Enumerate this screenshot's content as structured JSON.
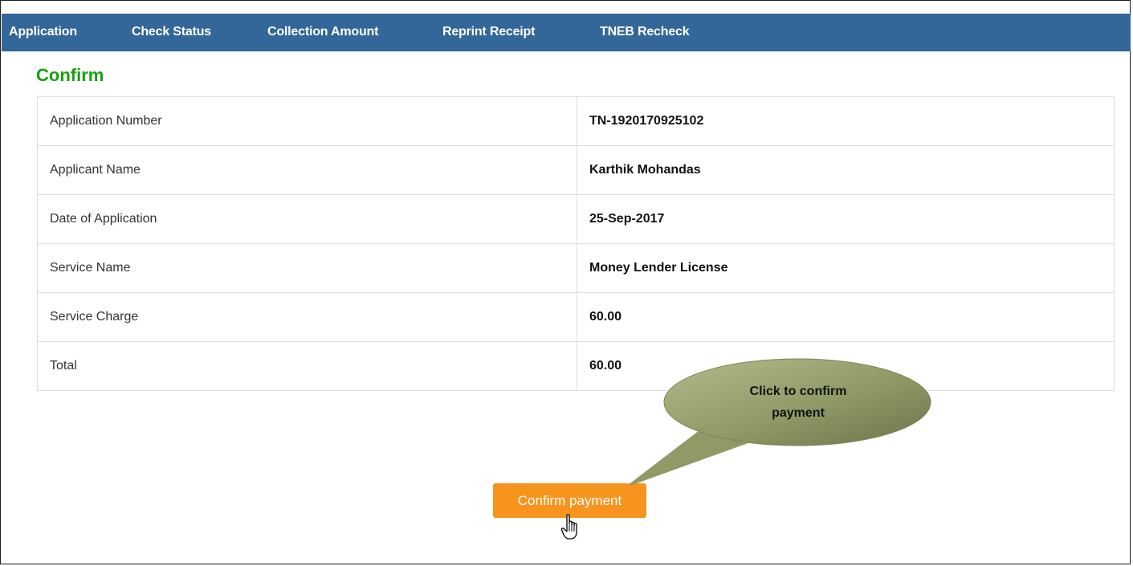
{
  "nav": {
    "items": [
      {
        "label": "Application"
      },
      {
        "label": "Check Status"
      },
      {
        "label": "Collection Amount"
      },
      {
        "label": "Reprint Receipt"
      },
      {
        "label": "TNEB Recheck"
      }
    ]
  },
  "page": {
    "title": "Confirm"
  },
  "details": {
    "rows": [
      {
        "label": "Application Number",
        "value": "TN-1920170925102"
      },
      {
        "label": "Applicant Name",
        "value": "Karthik Mohandas"
      },
      {
        "label": "Date of Application",
        "value": "25-Sep-2017"
      },
      {
        "label": "Service Name",
        "value": "Money Lender License"
      },
      {
        "label": "Service Charge",
        "value": "60.00"
      },
      {
        "label": "Total",
        "value": "60.00"
      }
    ]
  },
  "actions": {
    "confirm_label": "Confirm payment"
  },
  "callout": {
    "line1": "Click to confirm",
    "line2": "payment"
  },
  "colors": {
    "nav_bg": "#336699",
    "title": "#16a00f",
    "button": "#f7941d",
    "callout": "#8f9a66"
  },
  "icons": {
    "cursor": "hand-pointer-icon"
  }
}
